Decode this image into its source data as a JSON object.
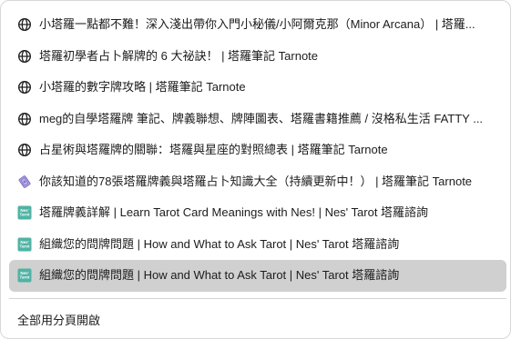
{
  "menu": {
    "items": [
      {
        "icon": "globe-icon",
        "label": "小塔羅一點都不難！深入淺出帶你入門小秘儀/小阿爾克那（Minor Arcana） | 塔羅..."
      },
      {
        "icon": "globe-icon",
        "label": "塔羅初學者占卜解牌的 6 大祕訣！ | 塔羅筆記 Tarnote"
      },
      {
        "icon": "globe-icon",
        "label": "小塔羅的數字牌攻略 | 塔羅筆記 Tarnote"
      },
      {
        "icon": "globe-icon",
        "label": "meg的自學塔羅牌 筆記、牌義聯想、牌陣圖表、塔羅書籍推薦 / 沒格私生活 FATTY ..."
      },
      {
        "icon": "globe-icon",
        "label": "占星術與塔羅牌的關聯：塔羅與星座的對照總表 | 塔羅筆記 Tarnote"
      },
      {
        "icon": "tarot-card-icon",
        "label": "你該知道的78張塔羅牌義與塔羅占卜知識大全（持續更新中！） | 塔羅筆記 Tarnote"
      },
      {
        "icon": "nes-tarot-favicon",
        "favicon_text": "Nes'\nTarot",
        "label": "塔羅牌義詳解 | Learn Tarot Card Meanings with Nes! | Nes' Tarot 塔羅諮詢"
      },
      {
        "icon": "nes-tarot-favicon",
        "favicon_text": "Nes'\nTarot",
        "label": "組織您的問牌問題 | How and What to Ask Tarot | Nes' Tarot 塔羅諮詢"
      },
      {
        "icon": "nes-tarot-favicon",
        "favicon_text": "Nes'\nTarot",
        "label": "組織您的問牌問題 | How and What to Ask Tarot | Nes' Tarot 塔羅諮詢",
        "selected": true
      }
    ],
    "open_all_label": "全部用分頁開啟"
  },
  "colors": {
    "selected_background": "#d0d0d0",
    "favicon_teal": "#4fb3a4",
    "tarot_icon_purple": "#7b6fc4"
  }
}
